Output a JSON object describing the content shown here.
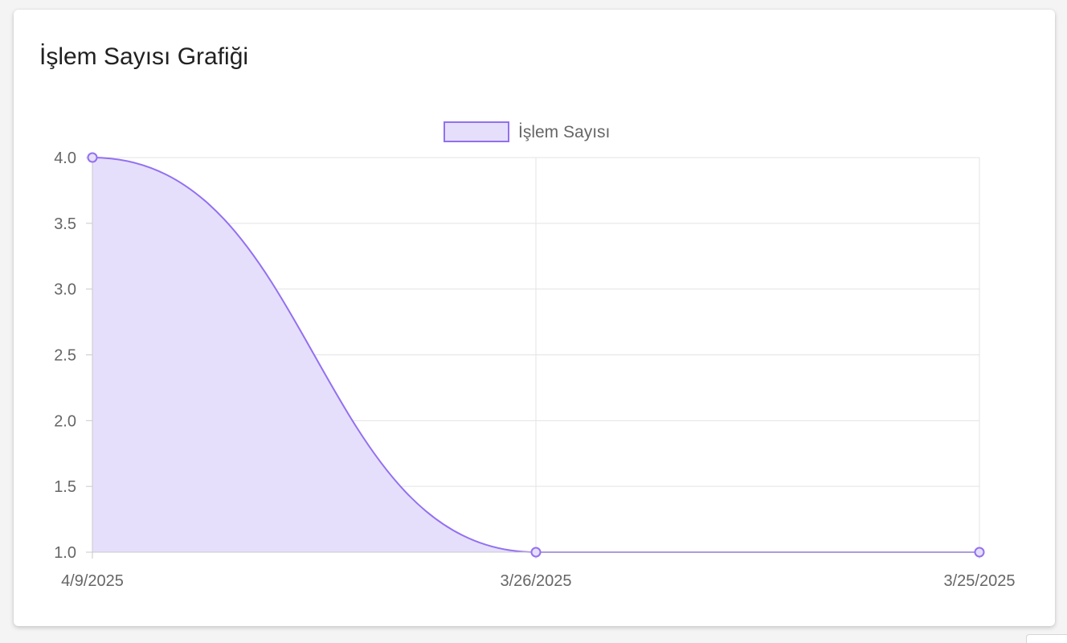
{
  "card": {
    "title": "İşlem Sayısı Grafiği"
  },
  "chart_data": {
    "type": "area",
    "title": "",
    "xlabel": "",
    "ylabel": "",
    "categories": [
      "4/9/2025",
      "3/26/2025",
      "3/25/2025"
    ],
    "series": [
      {
        "name": "İşlem Sayısı",
        "values": [
          4,
          1,
          1
        ]
      }
    ],
    "ylim": [
      1,
      4
    ],
    "yticks": [
      "1.0",
      "1.5",
      "2.0",
      "2.5",
      "3.0",
      "3.5",
      "4.0"
    ],
    "grid": true,
    "legend": "top-center",
    "colors": {
      "line": "#9370f0",
      "fill": "#e6dffc",
      "grid": "#e3e3e3",
      "axis": "#c9c9c9",
      "text": "#666666"
    }
  }
}
